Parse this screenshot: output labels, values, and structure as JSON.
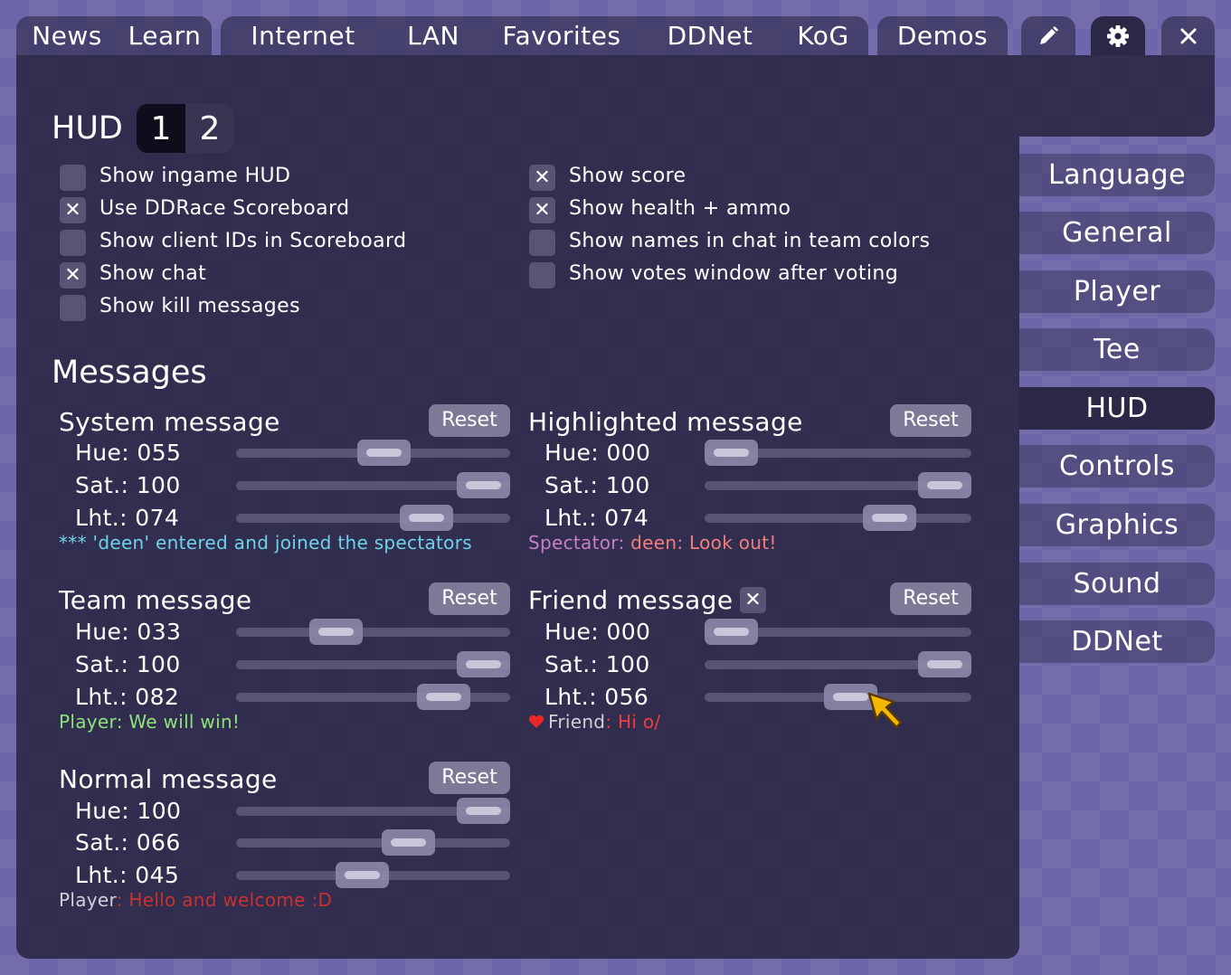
{
  "tabs": {
    "news": "News",
    "learn": "Learn",
    "internet": "Internet",
    "lan": "LAN",
    "favorites": "Favorites",
    "ddnet": "DDNet",
    "kog": "KoG",
    "demos": "Demos",
    "editor_icon": "pencil-icon",
    "settings_icon": "gear-icon",
    "close_icon": "close-icon"
  },
  "hud": {
    "title": "HUD",
    "page_1": "1",
    "page_2": "2",
    "selected_page": "1",
    "checkboxes_left": [
      {
        "label": "Show ingame HUD",
        "checked": false
      },
      {
        "label": "Use DDRace Scoreboard",
        "checked": true
      },
      {
        "label": "Show client IDs in Scoreboard",
        "checked": false
      },
      {
        "label": "Show chat",
        "checked": true
      },
      {
        "label": "Show kill messages",
        "checked": false
      }
    ],
    "checkboxes_right": [
      {
        "label": "Show score",
        "checked": true
      },
      {
        "label": "Show health + ammo",
        "checked": true
      },
      {
        "label": "Show names in chat in team colors",
        "checked": false
      },
      {
        "label": "Show votes window after voting",
        "checked": false
      }
    ]
  },
  "messages": {
    "title": "Messages",
    "reset_label": "Reset",
    "check_mark": "✕",
    "system": {
      "title": "System message",
      "hue": "Hue: 055",
      "sat": "Sat.: 100",
      "lht": "Lht.: 074",
      "hue_value": 55,
      "sat_value": 100,
      "lht_value": 74,
      "preview": "*** 'deen' entered and joined the spectators",
      "preview_color": "#6fd2ea"
    },
    "highlighted": {
      "title": "Highlighted message",
      "hue": "Hue: 000",
      "sat": "Sat.: 100",
      "lht": "Lht.: 074",
      "hue_value": 0,
      "sat_value": 100,
      "lht_value": 74,
      "preview_name": "Spectator",
      "preview_sep": ": ",
      "preview_name2": "deen",
      "preview_text": ": Look out!",
      "name_color": "#c87fc4",
      "text_color": "#f47e7e"
    },
    "team": {
      "title": "Team message",
      "hue": "Hue: 033",
      "sat": "Sat.: 100",
      "lht": "Lht.: 082",
      "hue_value": 33,
      "sat_value": 100,
      "lht_value": 82,
      "preview_name": "Player",
      "preview_text": ": We will win!",
      "preview_color": "#8fe27a"
    },
    "friend": {
      "title": "Friend message",
      "checked": true,
      "hue": "Hue: 000",
      "sat": "Sat.: 100",
      "lht": "Lht.: 056",
      "hue_value": 0,
      "sat_value": 100,
      "lht_value": 56,
      "preview_icon": "heart-icon",
      "preview_name": "Friend",
      "preview_text": ": Hi o/",
      "heart_color": "#e82828",
      "text_color": "#f03c3c"
    },
    "normal": {
      "title": "Normal message",
      "hue": "Hue: 100",
      "sat": "Sat.: 066",
      "lht": "Lht.: 045",
      "hue_value": 100,
      "sat_value": 66,
      "lht_value": 45,
      "preview_name": "Player",
      "preview_text": ": Hello and welcome :D",
      "text_color": "#c93030"
    }
  },
  "sidebar": {
    "items": [
      "Language",
      "General",
      "Player",
      "Tee",
      "HUD",
      "Controls",
      "Graphics",
      "Sound",
      "DDNet"
    ],
    "active": "HUD"
  },
  "colors": {
    "background": "#6d66a8",
    "panel": "#26233e",
    "cursor": "#f5b800"
  }
}
